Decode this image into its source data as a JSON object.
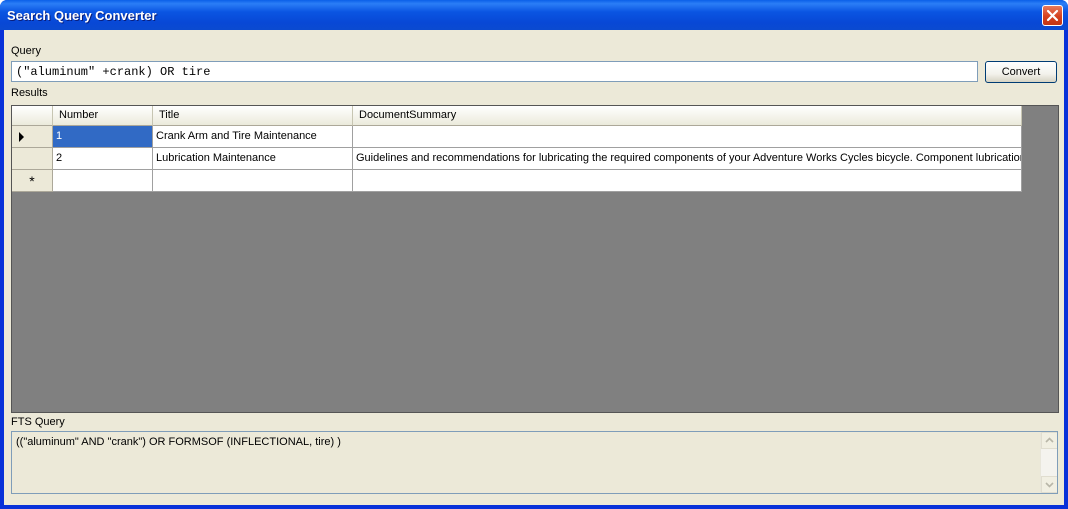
{
  "window": {
    "title": "Search Query Converter"
  },
  "query": {
    "label": "Query",
    "value": "(\"aluminum\" +crank) OR tire",
    "convert_label": "Convert"
  },
  "results": {
    "label": "Results",
    "columns": [
      "Number",
      "Title",
      "DocumentSummary"
    ],
    "rows": [
      {
        "number": "1",
        "title": "Crank Arm and Tire Maintenance",
        "summary": ""
      },
      {
        "number": "2",
        "title": "Lubrication Maintenance",
        "summary": "Guidelines and recommendations for lubricating the required components of your Adventure Works Cycles bicycle. Component lubrication i..."
      }
    ],
    "new_row_marker": "*",
    "current_row_marker": "▶"
  },
  "fts": {
    "label": "FTS Query",
    "value": "((\"aluminum\" AND  \"crank\") OR  FORMSOF (INFLECTIONAL, tire) )"
  },
  "colors": {
    "title_bar": "#0a55e2",
    "selection": "#316ac5",
    "grid_bg": "#808080",
    "window_bg": "#ece9d8"
  }
}
